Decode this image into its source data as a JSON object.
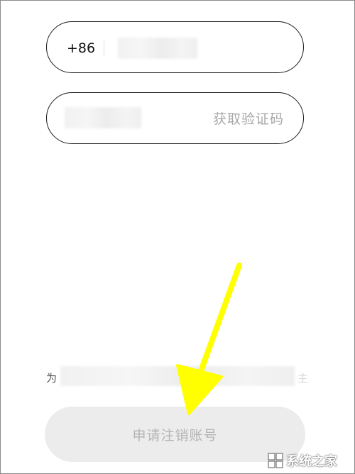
{
  "phone_field": {
    "country_code": "+86"
  },
  "code_field": {
    "get_code_label": "获取验证码"
  },
  "notice": {
    "prefix": "为",
    "suffix": "主"
  },
  "apply_button": {
    "label": "申请注销账号"
  },
  "watermark": {
    "text": "系统之家"
  },
  "colors": {
    "annotation_arrow": "#ffff00",
    "button_bg": "#ececec",
    "muted_text": "#a8a8a8"
  },
  "icons": {
    "annotation": "arrow-down-left-icon",
    "watermark": "windows-logo-icon"
  }
}
